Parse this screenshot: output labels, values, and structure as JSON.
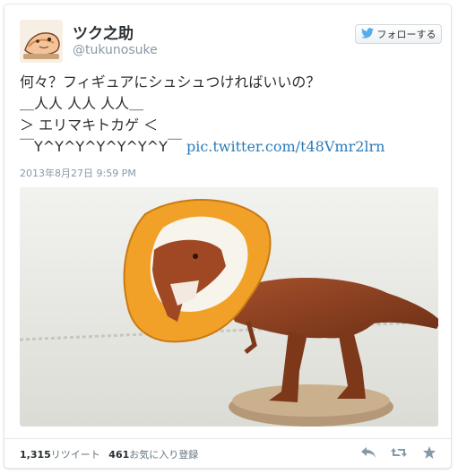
{
  "user": {
    "name": "ツク之助",
    "handle": "@tukunosuke"
  },
  "follow_button": {
    "label": "フォローする",
    "icon": "twitter-bird-icon",
    "icon_color": "#55acee"
  },
  "tweet": {
    "lines": [
      "何々？フィギュアにシュシュつければいいの？",
      "＿人人 人人 人人＿",
      "＞ エリマキトカゲ ＜",
      "￣Y^Y^Y^Y^Y^Y^Y￣"
    ],
    "link": "pic.twitter.com/t48Vmr2lrn",
    "timestamp": "2013年8月27日  9:59 PM"
  },
  "stats": {
    "retweet_count": "1,315",
    "retweet_label": "リツイート",
    "favorite_count": "461",
    "favorite_label": "お気に入り登録"
  },
  "actions": [
    {
      "name": "reply-icon"
    },
    {
      "name": "retweet-icon"
    },
    {
      "name": "favorite-star-icon"
    }
  ],
  "colors": {
    "link": "#2b7bb9",
    "muted": "#8899a6",
    "icon": "#8899a6"
  }
}
